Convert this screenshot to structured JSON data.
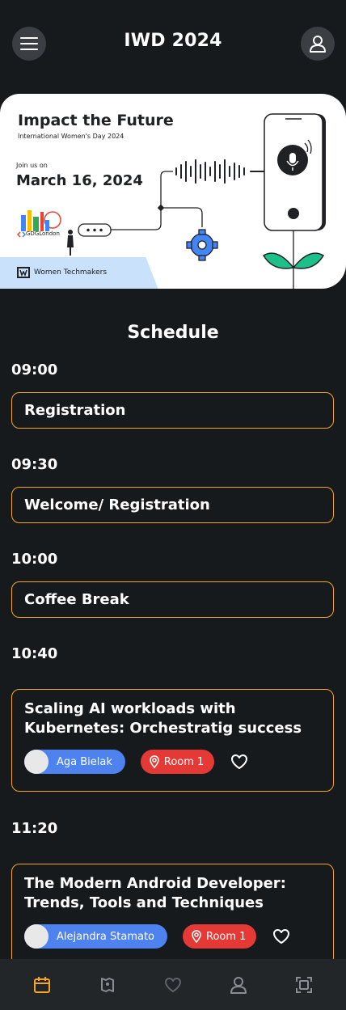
{
  "app": {
    "title": "IWD 2024"
  },
  "banner": {
    "title": "Impact the Future",
    "subtitle": "International Women's Day 2024",
    "join": "Join us on",
    "date": "March 16, 2024",
    "gdg": "GDGLondon",
    "wtm": "Women Techmakers"
  },
  "schedule": {
    "title": "Schedule",
    "slots": [
      {
        "time": "09:00",
        "title": "Registration"
      },
      {
        "time": "09:30",
        "title": "Welcome/ Registration"
      },
      {
        "time": "10:00",
        "title": "Coffee Break"
      },
      {
        "time": "10:40",
        "title": "Scaling AI workloads with Kubernetes: Orchestratig success",
        "speaker": "Aga Bielak",
        "room": "Room 1"
      },
      {
        "time": "11:20",
        "title": "The Modern Android Developer: Trends, Tools and Techniques",
        "speaker": "Alejandra Stamato",
        "room": "Room 1"
      }
    ]
  },
  "colors": {
    "accent": "#f5a623",
    "speaker": "#4e82ee",
    "room": "#e53935",
    "background": "#161a1d"
  },
  "nav": {
    "items": [
      "calendar-icon",
      "map-icon",
      "heart-icon",
      "person-icon",
      "scan-icon"
    ],
    "active": "calendar-icon"
  }
}
